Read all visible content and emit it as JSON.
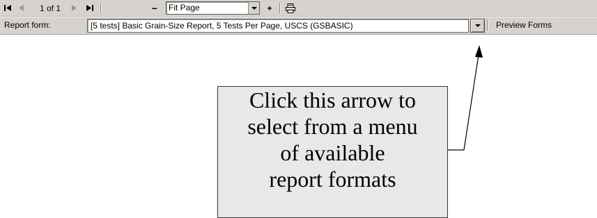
{
  "toolbar": {
    "first_page_icon": "first-page-icon",
    "prev_page_icon": "previous-page-icon",
    "page_indicator": "1 of 1",
    "next_page_icon": "next-page-icon",
    "last_page_icon": "last-page-icon",
    "zoom_out_label": "−",
    "zoom_value": "Fit Page",
    "zoom_in_label": "+",
    "print_icon": "printer-icon"
  },
  "report_bar": {
    "label": "Report form:",
    "selected_form": "[5 tests] Basic Grain-Size Report, 5 Tests Per Page, USCS (GSBASIC)",
    "dropdown_icon": "dropdown-arrow-icon",
    "preview_label": "Preview Forms"
  },
  "callout": {
    "lines": [
      "Click this arrow to",
      "select from a menu",
      "of available",
      "report formats"
    ]
  }
}
